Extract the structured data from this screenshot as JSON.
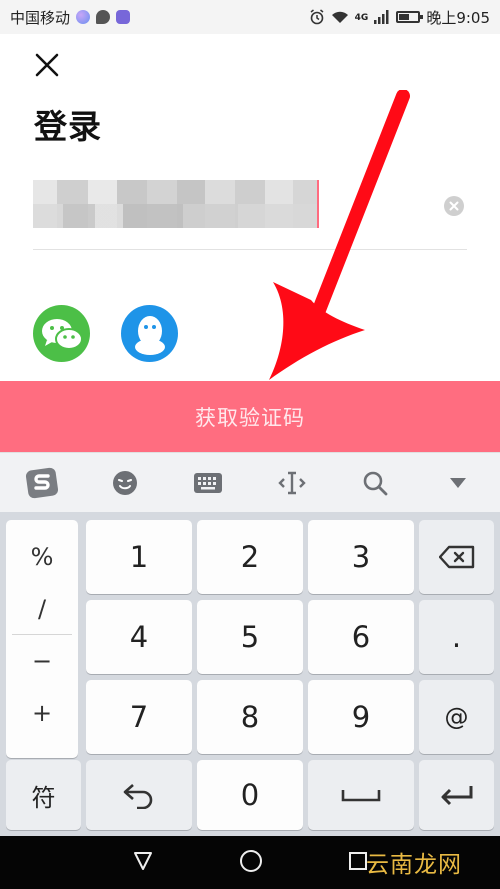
{
  "status_bar": {
    "carrier": "中国移动",
    "network": "4G",
    "time": "晚上9:05",
    "battery_level": 0.55
  },
  "login": {
    "title": "登录",
    "get_code_label": "获取验证码"
  },
  "keyboard": {
    "symbols": [
      "%",
      "/",
      "−",
      "+"
    ],
    "digits": [
      [
        "1",
        "2",
        "3"
      ],
      [
        "4",
        "5",
        "6"
      ],
      [
        "7",
        "8",
        "9"
      ]
    ],
    "right_keys": [
      ".",
      "@"
    ],
    "bottom": {
      "symbol_key": "符",
      "zero": "0"
    }
  },
  "watermark": {
    "text": "云南龙网"
  },
  "colors": {
    "accent": "#ff6d80",
    "arrow": "#ff0a16",
    "wechat": "#4cbf47",
    "qq": "#1e94e8"
  }
}
